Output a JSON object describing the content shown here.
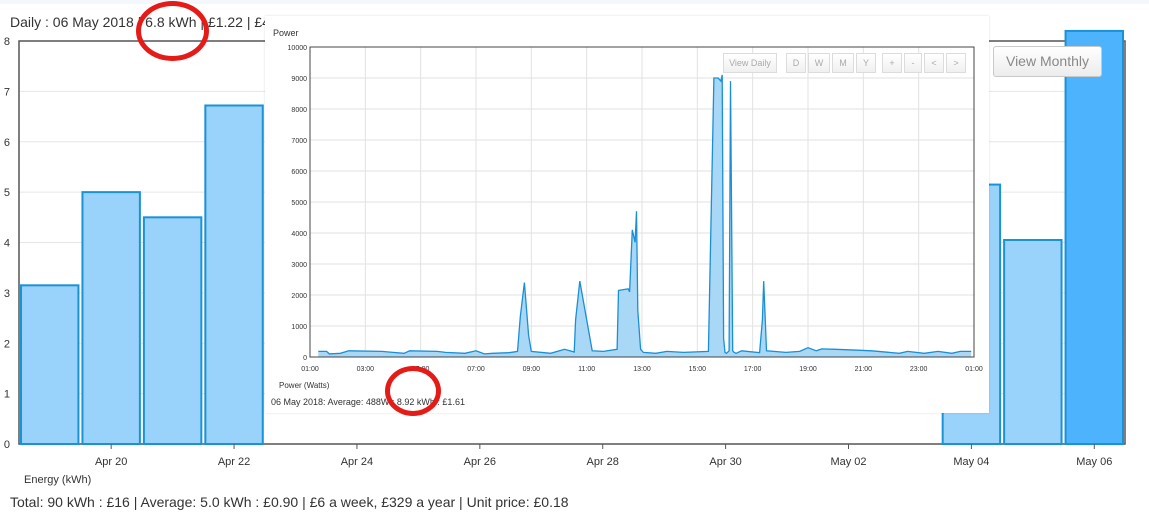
{
  "header": {
    "prefix": "Daily : 06 May 2018",
    "energy": "6.8 kWh",
    "cost": "£1.22 | £4"
  },
  "buttons": {
    "view_monthly": "View Monthly"
  },
  "footer": {
    "energy_label": "Energy (kWh)",
    "summary": "Total: 90 kWh : £16 | Average: 5.0 kWh : £0.90 | £6 a week, £329 a year | Unit price: £0.18"
  },
  "colors": {
    "bar_fill": "#99d2fb",
    "bar_stroke": "#1a92d6",
    "bar_selected": "#4db3fc",
    "highlight_ring": "#e41b17",
    "line": "#1a8fd6",
    "area": "#a9d8f6"
  },
  "chart_data": [
    {
      "type": "bar",
      "title": "",
      "xlabel": "",
      "ylabel": "Energy (kWh)",
      "ylim": [
        0,
        8
      ],
      "yticks": [
        "0",
        "1",
        "2",
        "3",
        "4",
        "5",
        "6",
        "7",
        "8"
      ],
      "grid": true,
      "x_tick_labels": [
        "Apr 20",
        "Apr 22",
        "Apr 24",
        "Apr 26",
        "Apr 28",
        "Apr 30",
        "May 02",
        "May 04",
        "May 06"
      ],
      "categories": [
        "Apr 19",
        "Apr 20",
        "Apr 21",
        "Apr 22",
        "Apr 23",
        "Apr 24",
        "Apr 25",
        "Apr 26",
        "Apr 27",
        "Apr 28",
        "Apr 29",
        "Apr 30",
        "May 01",
        "May 02",
        "May 03",
        "May 04",
        "May 05",
        "May 06"
      ],
      "values": [
        3.15,
        5.0,
        4.5,
        6.72,
        null,
        null,
        null,
        null,
        null,
        null,
        null,
        null,
        null,
        null,
        null,
        5.15,
        4.05,
        8.2
      ],
      "selected": "May 06"
    },
    {
      "type": "area",
      "title": "Power",
      "xlabel": "",
      "ylabel": "Power (Watts)",
      "ylim": [
        0,
        10000
      ],
      "yticks": [
        "0",
        "1000",
        "2000",
        "3000",
        "4000",
        "5000",
        "6000",
        "7000",
        "8000",
        "9000",
        "10000"
      ],
      "x_tick_labels": [
        "01:00",
        "03:00",
        "05:00",
        "07:00",
        "09:00",
        "11:00",
        "13:00",
        "15:00",
        "17:00",
        "19:00",
        "21:00",
        "23:00",
        "01:00"
      ],
      "xlim": [
        1,
        25
      ],
      "grid": true,
      "x": [
        1.3,
        1.6,
        1.7,
        2.1,
        2.4,
        3.6,
        4.0,
        4.4,
        4.6,
        5.6,
        5.9,
        6.6,
        7.0,
        7.3,
        7.6,
        8.2,
        8.5,
        8.6,
        8.75,
        8.9,
        9.0,
        9.7,
        10.2,
        10.55,
        10.6,
        10.75,
        11.2,
        11.6,
        12.1,
        12.15,
        12.5,
        12.55,
        12.65,
        12.75,
        12.8,
        12.85,
        12.95,
        13.05,
        13.5,
        13.9,
        14.5,
        15.4,
        15.6,
        15.75,
        15.85,
        15.9,
        15.95,
        16.0,
        16.05,
        16.15,
        16.2,
        16.28,
        16.33,
        16.4,
        16.6,
        17.25,
        17.35,
        17.4,
        17.5,
        18.2,
        18.7,
        19.0,
        19.3,
        19.5,
        20.0,
        20.8,
        21.3,
        22.3,
        22.6,
        23.2,
        23.7,
        24.2,
        24.5,
        24.9
      ],
      "values": [
        180,
        180,
        100,
        120,
        200,
        180,
        150,
        120,
        200,
        180,
        150,
        120,
        200,
        100,
        120,
        140,
        180,
        1300,
        2400,
        700,
        180,
        120,
        250,
        160,
        1200,
        2450,
        200,
        180,
        250,
        2150,
        2200,
        2100,
        4100,
        3700,
        4700,
        1500,
        250,
        150,
        120,
        180,
        150,
        180,
        9000,
        9000,
        8900,
        9100,
        600,
        150,
        120,
        200,
        8900,
        200,
        150,
        120,
        200,
        140,
        1200,
        2450,
        200,
        150,
        180,
        300,
        200,
        260,
        250,
        220,
        200,
        120,
        180,
        120,
        180,
        120,
        180,
        180
      ]
    }
  ],
  "inset": {
    "title": "Power",
    "ylabel": "Power (Watts)",
    "summary": "06 May 2018: Average: 488W : 8.92 kWh : £1.61",
    "toolbar": {
      "view_daily": "View Daily",
      "d": "D",
      "w": "W",
      "m": "M",
      "y": "Y",
      "plus": "+",
      "minus": "-",
      "prev": "<",
      "next": ">"
    }
  }
}
